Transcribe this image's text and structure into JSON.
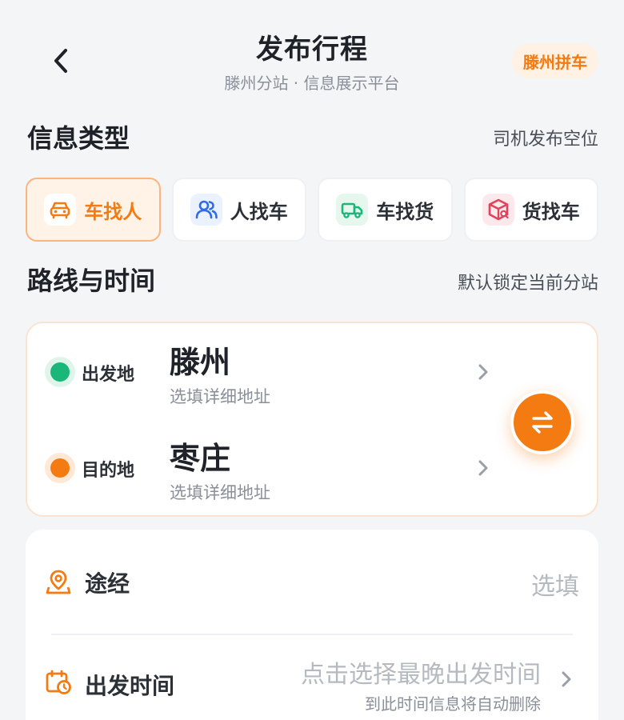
{
  "header": {
    "title": "发布行程",
    "subtitle": "滕州分站 · 信息展示平台",
    "city_badge": "滕州拼车"
  },
  "info_type": {
    "title": "信息类型",
    "note": "司机发布空位",
    "tabs": [
      {
        "label": "车找人",
        "icon": "car-icon",
        "active": true
      },
      {
        "label": "人找车",
        "icon": "users-icon",
        "active": false
      },
      {
        "label": "车找货",
        "icon": "truck-icon",
        "active": false
      },
      {
        "label": "货找车",
        "icon": "package-icon",
        "active": false
      }
    ]
  },
  "route": {
    "title": "路线与时间",
    "note": "默认锁定当前分站",
    "origin": {
      "label": "出发地",
      "city": "滕州",
      "hint": "选填详细地址"
    },
    "destination": {
      "label": "目的地",
      "city": "枣庄",
      "hint": "选填详细地址"
    },
    "swap_icon": "swap-icon"
  },
  "details": {
    "via": {
      "label": "途经",
      "value": "选填",
      "icon": "location-pin-icon"
    },
    "departure": {
      "label": "出发时间",
      "value": "点击选择最晚出发时间",
      "sub": "到此时间信息将自动删除",
      "icon": "calendar-clock-icon"
    }
  },
  "colors": {
    "accent": "#f47a12",
    "origin_dot": "#1bb67a",
    "destination_dot": "#f47a12",
    "background": "#f4f5f7"
  }
}
